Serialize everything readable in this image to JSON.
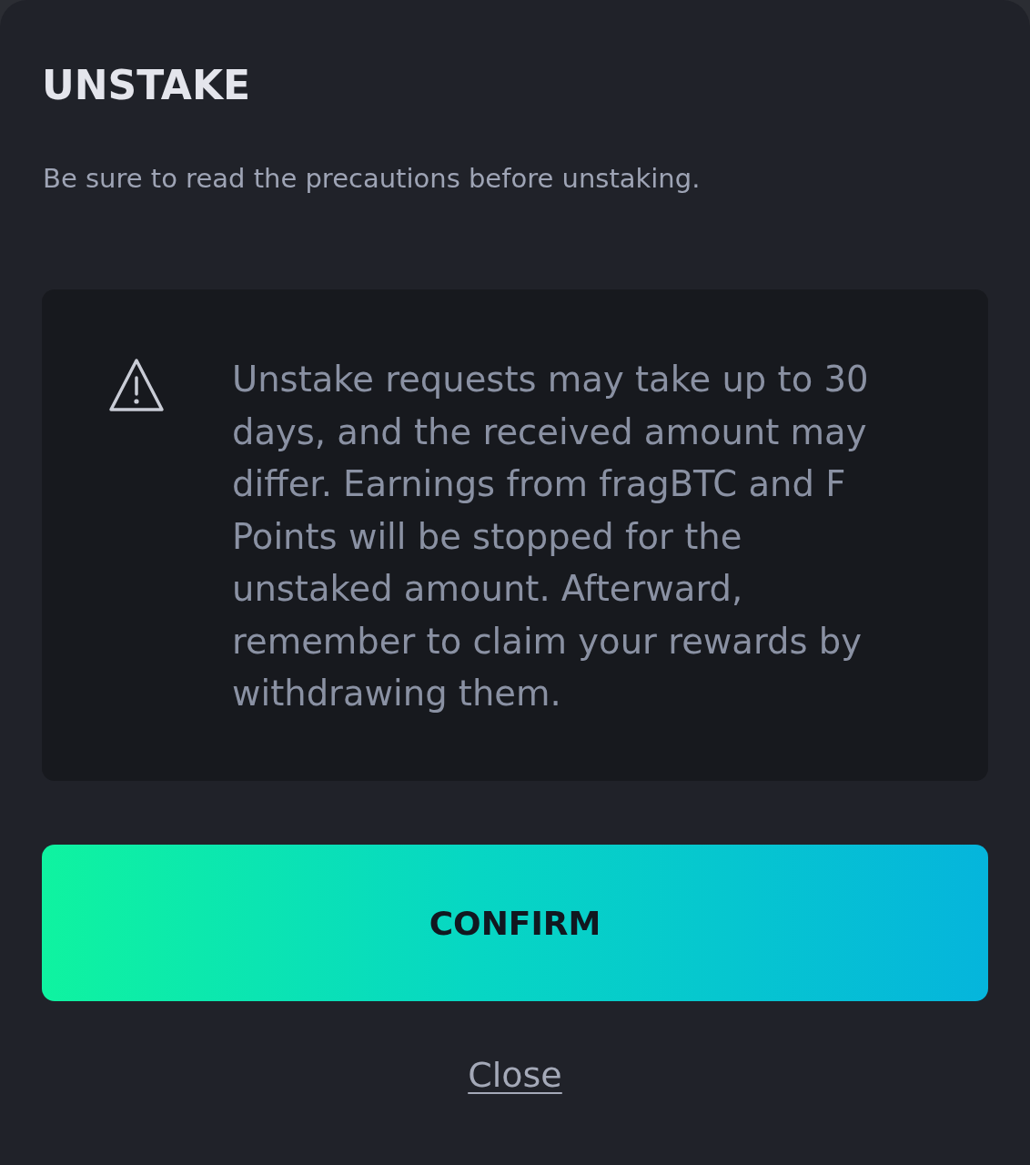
{
  "dialog": {
    "title": "UNSTAKE",
    "subtitle": "Be sure to read the precautions before unstaking."
  },
  "notice": {
    "text": "Unstake requests may take up to 30 days, and the received amount may differ. Earnings from fragBTC and F Points will be stopped for the unstaked amount. Afterward, remember to claim your rewards by withdrawing them."
  },
  "actions": {
    "confirm": "CONFIRM",
    "close": "Close"
  }
}
